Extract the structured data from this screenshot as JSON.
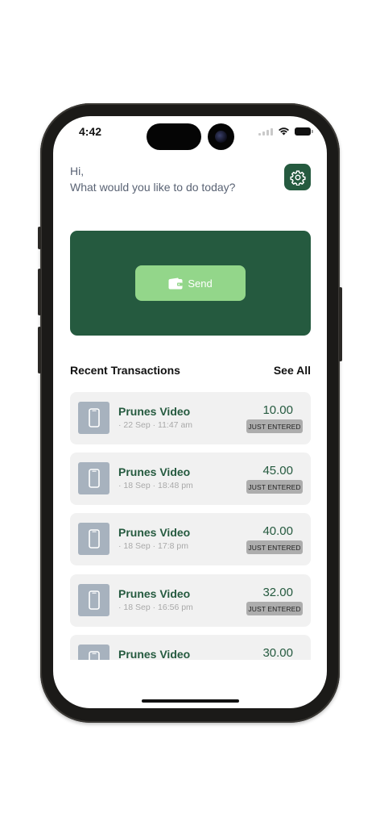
{
  "status_bar": {
    "time": "4:42"
  },
  "header": {
    "greeting_line1": "Hi,",
    "greeting_line2": "What would you like to do today?",
    "settings_icon": "gear-icon"
  },
  "hero": {
    "send_label": "Send",
    "send_icon": "wallet-icon"
  },
  "section": {
    "title": "Recent Transactions",
    "see_all": "See All"
  },
  "transactions": [
    {
      "title": "Prunes Video",
      "meta": "· 22 Sep · 11:47 am",
      "amount": "10.00",
      "status": "JUST ENTERED"
    },
    {
      "title": "Prunes Video",
      "meta": "· 18 Sep · 18:48 pm",
      "amount": "45.00",
      "status": "JUST ENTERED"
    },
    {
      "title": "Prunes Video",
      "meta": "· 18 Sep · 17:8 pm",
      "amount": "40.00",
      "status": "JUST ENTERED"
    },
    {
      "title": "Prunes Video",
      "meta": "· 18 Sep · 16:56 pm",
      "amount": "32.00",
      "status": "JUST ENTERED"
    },
    {
      "title": "Prunes Video",
      "meta": "",
      "amount": "30.00",
      "status": ""
    }
  ],
  "colors": {
    "brand_green": "#255a3f",
    "send_button": "#93d68a",
    "card_bg": "#f1f1f1",
    "badge_bg": "#adadad"
  }
}
